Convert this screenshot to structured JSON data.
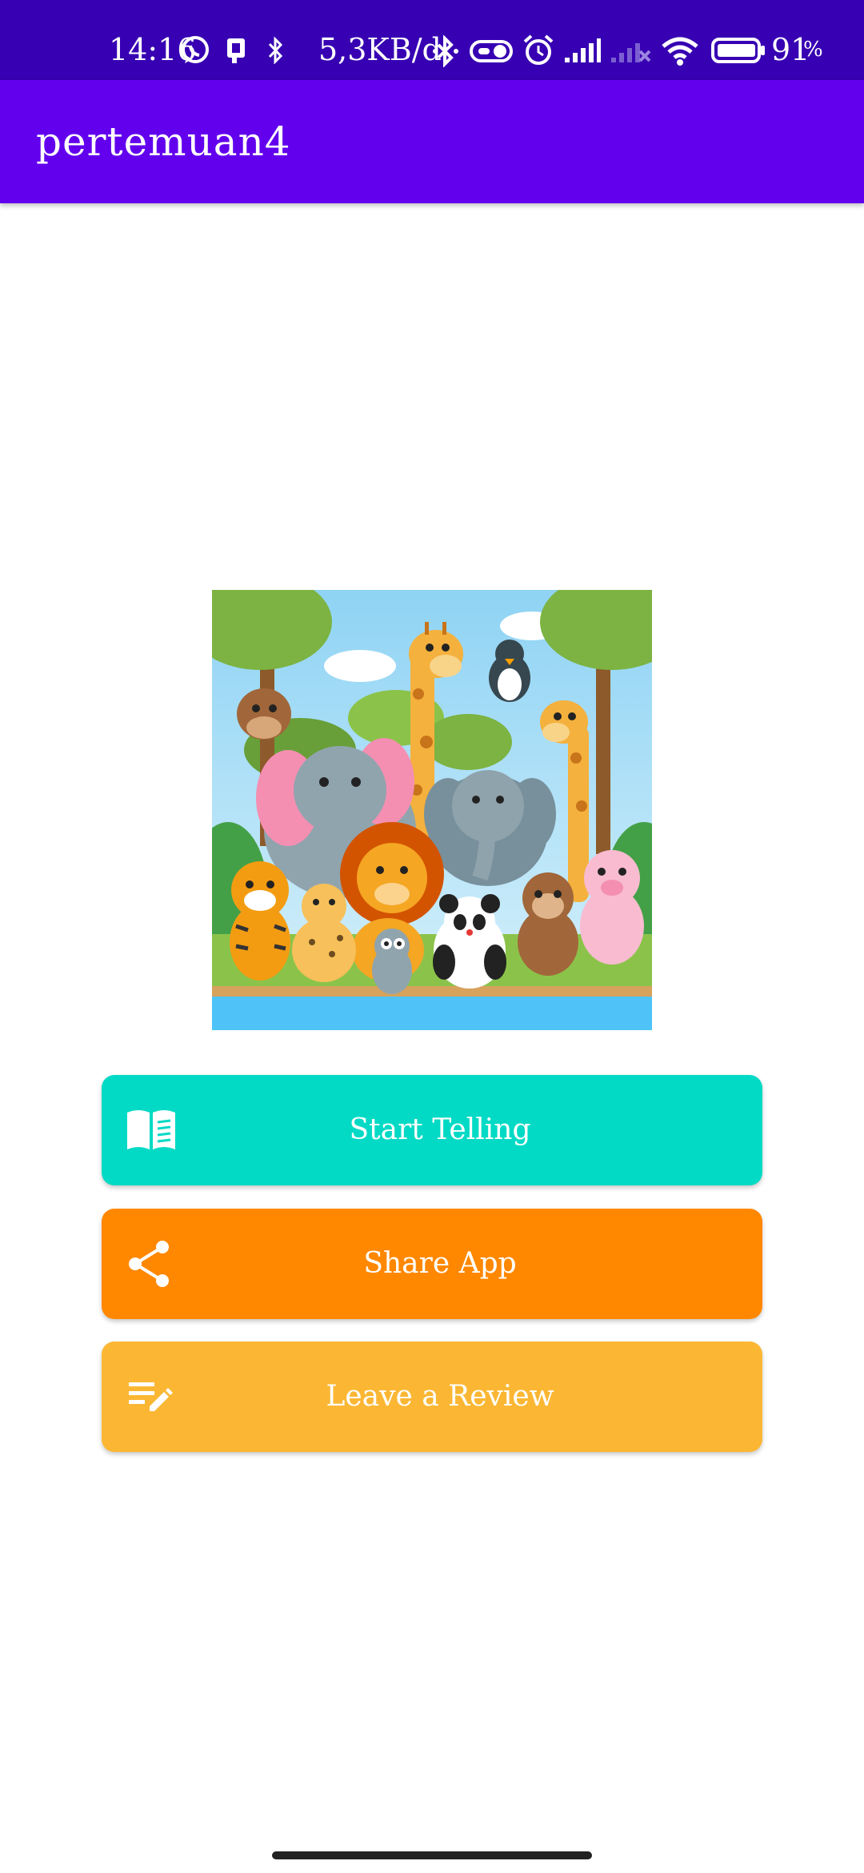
{
  "status_bar": {
    "time": "14:16",
    "net_speed": "5,3KB/d",
    "battery_percent": "91",
    "battery_unit": "%",
    "background": "#3700b3"
  },
  "app_bar": {
    "title": "pertemuan4",
    "background": "#6200ee"
  },
  "hero": {
    "image": "cartoon-jungle-animals-illustration"
  },
  "actions": [
    {
      "label": "Start Telling",
      "icon": "book-icon",
      "color": "#03dac5"
    },
    {
      "label": "Share App",
      "icon": "share-icon",
      "color": "#ff8800"
    },
    {
      "label": "Leave a Review",
      "icon": "rate-review-icon",
      "color": "#fbb734"
    }
  ]
}
